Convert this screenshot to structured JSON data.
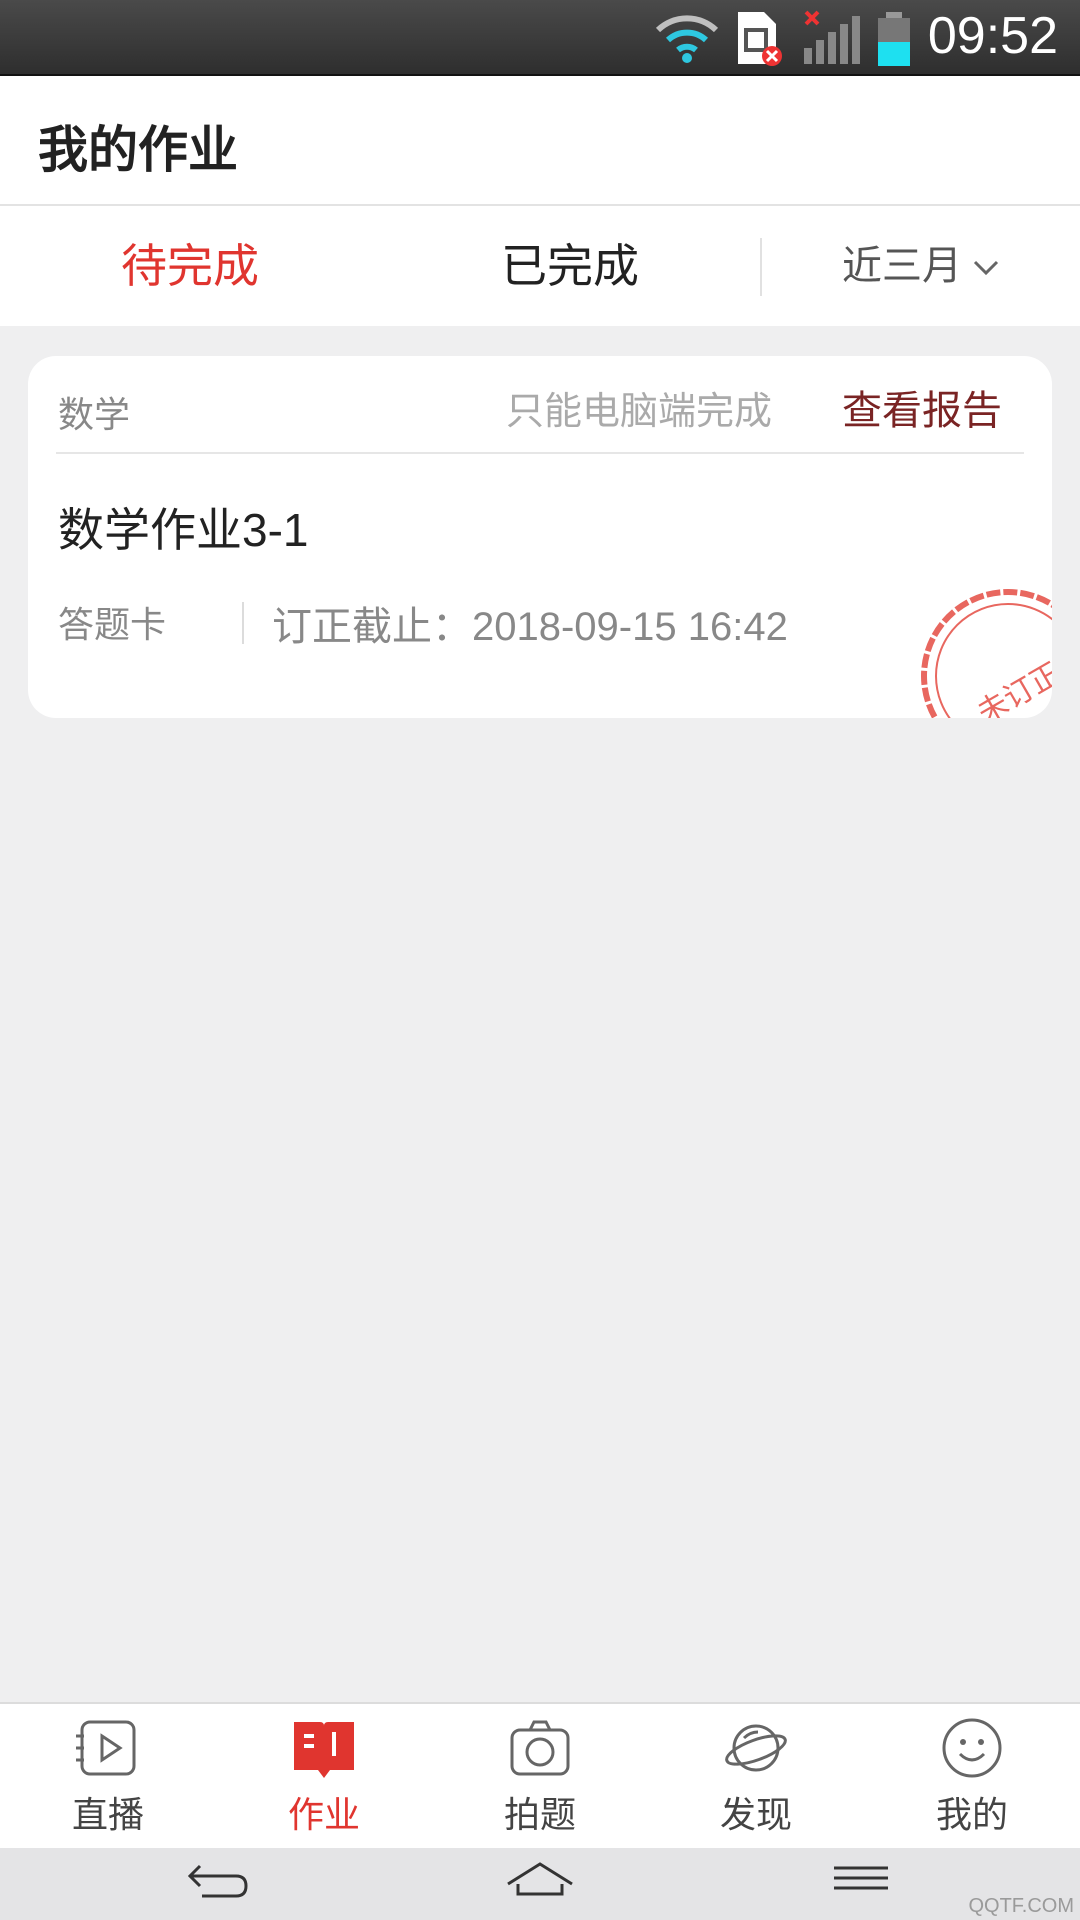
{
  "status_bar": {
    "time": "09:52"
  },
  "header": {
    "title": "我的作业"
  },
  "tabs": {
    "pending": "待完成",
    "completed": "已完成",
    "range": "近三月"
  },
  "colors": {
    "accent": "#e0352f",
    "report": "#7a2424",
    "stamp": "#e8675f"
  },
  "homework": [
    {
      "subject": "数学",
      "note": "只能电脑端完成",
      "action": "查看报告",
      "title": "数学作业3-1",
      "type": "答题卡",
      "deadline": "订正截止：2018-09-15  16:42",
      "stamp": "未订正"
    }
  ],
  "bottom_nav": [
    {
      "label": "直播",
      "icon": "play-icon",
      "active": false
    },
    {
      "label": "作业",
      "icon": "book-icon",
      "active": true
    },
    {
      "label": "拍题",
      "icon": "camera-icon",
      "active": false
    },
    {
      "label": "发现",
      "icon": "planet-icon",
      "active": false
    },
    {
      "label": "我的",
      "icon": "smiley-icon",
      "active": false
    }
  ],
  "watermark": "QQTF.COM"
}
